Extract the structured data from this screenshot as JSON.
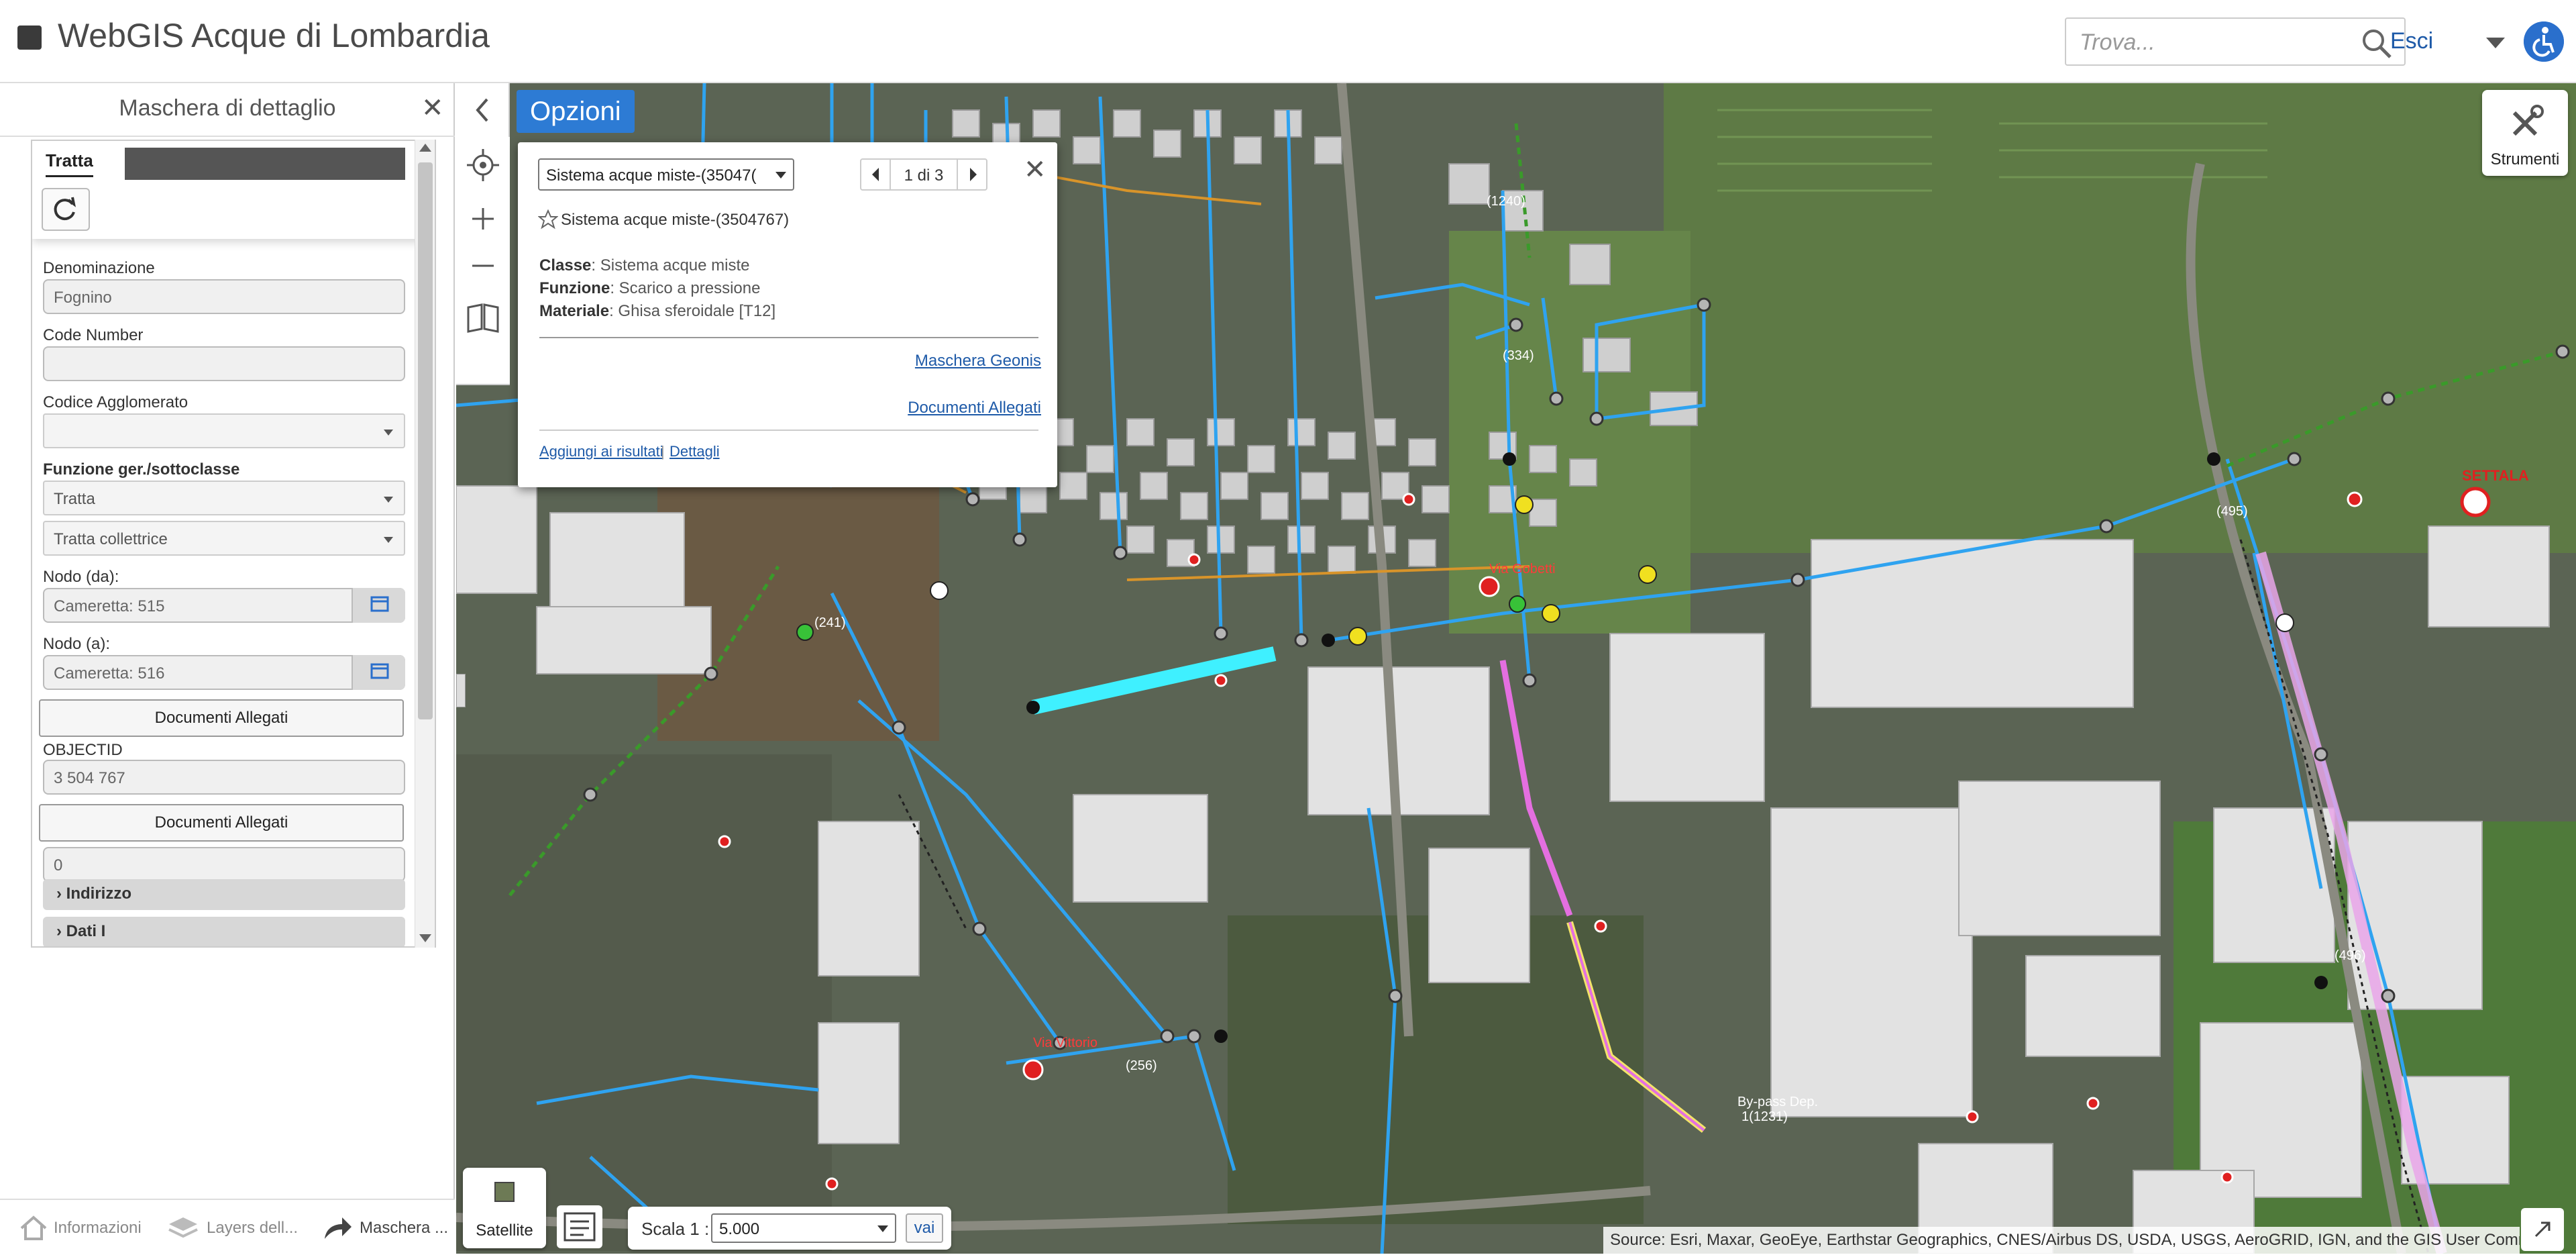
{
  "app": {
    "title": "WebGIS Acque di Lombardia"
  },
  "header": {
    "search_placeholder": "Trova...",
    "exit_label": "Esci"
  },
  "left_panel": {
    "title": "Maschera di dettaglio",
    "tab_label": "Tratta",
    "fields": {
      "denominazione": {
        "label": "Denominazione",
        "value": "Fognino"
      },
      "code_number": {
        "label": "Code Number",
        "value": ""
      },
      "codice_agglomerato": {
        "label": "Codice Agglomerato",
        "value": ""
      },
      "funzione": {
        "label": "Funzione ger./sottoclasse",
        "value1": "Tratta",
        "value2": "Tratta collettrice"
      },
      "nodo_da": {
        "label": "Nodo (da):",
        "value": "Cameretta: 515"
      },
      "nodo_a": {
        "label": "Nodo (a):",
        "value": "Cameretta: 516"
      },
      "objectid": {
        "label": "OBJECTID",
        "value": "3 504 767"
      },
      "extra_value": "0"
    },
    "doc_button_label": "Documenti Allegati",
    "accordions": [
      "Indirizzo",
      "Dati I"
    ]
  },
  "bottom_tabs": [
    {
      "label": "Informazioni",
      "icon": "home-icon"
    },
    {
      "label": "Layers dell...",
      "icon": "layers-icon"
    },
    {
      "label": "Maschera ...",
      "icon": "share-arrow-icon"
    }
  ],
  "map": {
    "options_label": "Opzioni",
    "tools_label": "Strumenti",
    "satellite_label": "Satellite",
    "scale_label": "Scala 1 :",
    "scale_value": "5.000",
    "scale_go_label": "vai",
    "attribution": "Source: Esri, Maxar, GeoEye, Earthstar Geographics, CNES/Airbus DS, USDA, USGS, AeroGRID, IGN, and the GIS User Comm",
    "labels": [
      "(1240)",
      "(334)",
      "(495)",
      "(241)",
      "(256)",
      "(496)",
      "SETTALA",
      "Via Gobetti",
      "Via Vittorio",
      "By-pass Dep.",
      "1(1231)"
    ]
  },
  "popup": {
    "select_value": "Sistema acque miste-(35047(",
    "pager": "1 di 3",
    "feature_title": "Sistema acque miste-(3504767)",
    "attributes": [
      {
        "key": "Classe",
        "value": "Sistema acque miste"
      },
      {
        "key": "Funzione",
        "value": "Scarico a pressione"
      },
      {
        "key": "Materiale",
        "value": "Ghisa sferoidale [T12]"
      }
    ],
    "links": {
      "maschera": "Maschera Geonis",
      "documenti": "Documenti Allegati",
      "results": "Aggiungi ai risultati",
      "details": "Dettagli"
    }
  },
  "colors": {
    "accent": "#2d7bd4",
    "link": "#1e5aa8",
    "pipe_blue": "#2fa3f0",
    "pipe_pink": "#e889e8",
    "pipe_highlight": "#3ff0ff"
  }
}
